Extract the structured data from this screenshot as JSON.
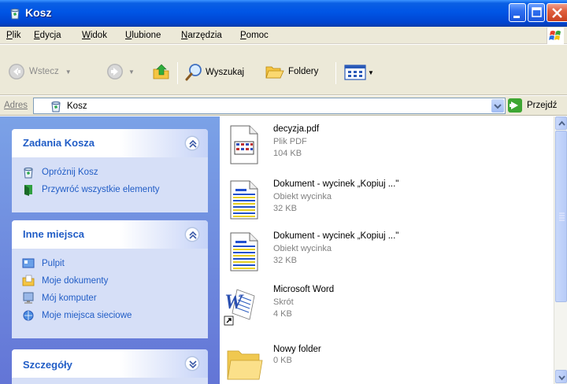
{
  "window": {
    "title": "Kosz"
  },
  "menu": {
    "items": [
      "Plik",
      "Edycja",
      "Widok",
      "Ulubione",
      "Narzędzia",
      "Pomoc"
    ]
  },
  "toolbar": {
    "back_label": "Wstecz",
    "search_label": "Wyszukaj",
    "folders_label": "Foldery"
  },
  "address": {
    "label": "Adres",
    "value": "Kosz",
    "go_label": "Przejdź"
  },
  "tasks": {
    "panel1": {
      "title": "Zadania Kosza",
      "items": [
        "Opróżnij Kosz",
        "Przywróć wszystkie elementy"
      ]
    },
    "panel2": {
      "title": "Inne miejsca",
      "items": [
        "Pulpit",
        "Moje dokumenty",
        "Mój komputer",
        "Moje miejsca sieciowe"
      ]
    },
    "panel3": {
      "title": "Szczegóły"
    }
  },
  "files": [
    {
      "name": "decyzja.pdf",
      "type": "Plik PDF",
      "size": "104 KB",
      "icon": "pdf-file-icon"
    },
    {
      "name": "Dokument - wycinek „Kopiuj ...\"",
      "type": "Obiekt wycinka",
      "size": "32 KB",
      "icon": "scrap-document-icon"
    },
    {
      "name": "Dokument - wycinek „Kopiuj ...\"",
      "type": "Obiekt wycinka",
      "size": "32 KB",
      "icon": "scrap-document-icon"
    },
    {
      "name": "Microsoft Word",
      "type": "Skrót",
      "size": "4 KB",
      "icon": "word-shortcut-icon"
    },
    {
      "name": "Nowy folder",
      "type": "",
      "size": "0 KB",
      "icon": "folder-icon"
    }
  ],
  "colors": {
    "titlebar": "#0055e5",
    "taskpane": "#7ba2e7",
    "link": "#215dc6"
  }
}
